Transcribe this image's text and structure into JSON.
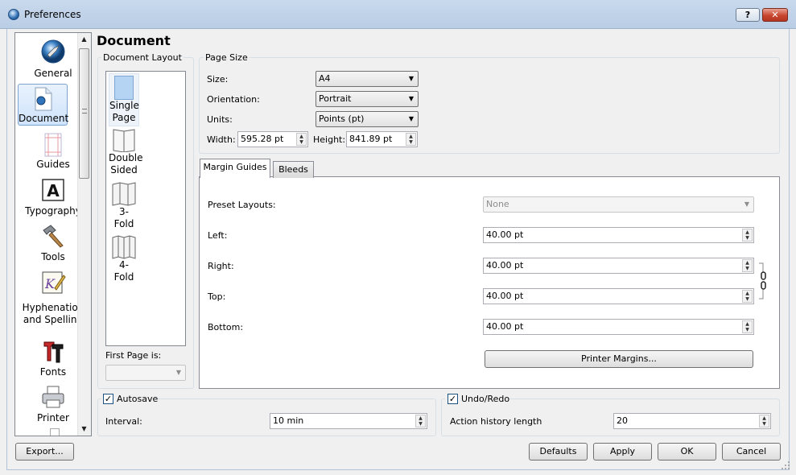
{
  "window": {
    "title": "Preferences",
    "help_label": "?",
    "close_label": "✕"
  },
  "sidebar": {
    "items": [
      {
        "label": "General",
        "icon": "globe-icon"
      },
      {
        "label": "Document",
        "icon": "document-icon",
        "selected": true
      },
      {
        "label": "Guides",
        "icon": "guides-icon"
      },
      {
        "label": "Typography",
        "icon": "typography-icon"
      },
      {
        "label": "Tools",
        "icon": "hammer-icon"
      },
      {
        "label1": "Hyphenation",
        "label2": "and Spelling",
        "icon": "pen-icon"
      },
      {
        "label": "Fonts",
        "icon": "fonts-icon"
      },
      {
        "label": "Printer",
        "icon": "printer-icon"
      }
    ]
  },
  "page": {
    "title": "Document"
  },
  "document_layout": {
    "title": "Document Layout",
    "items": [
      {
        "line1": "Single",
        "line2": "Page",
        "selected": true
      },
      {
        "line1": "Double",
        "line2": "Sided"
      },
      {
        "line1": "3-",
        "line2": "Fold"
      },
      {
        "line1": "4-",
        "line2": "Fold"
      }
    ],
    "first_page_label": "First Page is:",
    "first_page_value": ""
  },
  "page_size": {
    "title": "Page Size",
    "size_label": "Size:",
    "size_value": "A4",
    "orientation_label": "Orientation:",
    "orientation_value": "Portrait",
    "units_label": "Units:",
    "units_value": "Points (pt)",
    "width_label": "Width:",
    "width_value": "595.28 pt",
    "height_label": "Height:",
    "height_value": "841.89 pt"
  },
  "tabs": {
    "margin_guides": "Margin Guides",
    "bleeds": "Bleeds",
    "active": "margin_guides"
  },
  "margins": {
    "preset_label": "Preset Layouts:",
    "preset_value": "None",
    "left_label": "Left:",
    "left_value": "40.00 pt",
    "right_label": "Right:",
    "right_value": "40.00 pt",
    "top_label": "Top:",
    "top_value": "40.00 pt",
    "bottom_label": "Bottom:",
    "bottom_value": "40.00 pt",
    "printer_margins_label": "Printer Margins..."
  },
  "autosave": {
    "label": "Autosave",
    "checked": true,
    "interval_label": "Interval:",
    "interval_value": "10 min"
  },
  "undo": {
    "label": "Undo/Redo",
    "checked": true,
    "history_label": "Action history length",
    "history_value": "20"
  },
  "buttons": {
    "export": "Export...",
    "defaults": "Defaults",
    "apply": "Apply",
    "ok": "OK",
    "cancel": "Cancel"
  },
  "colors": {
    "titlebar": "#c4d5ea",
    "selection": "#cfe3fb",
    "close": "#c8452f"
  }
}
